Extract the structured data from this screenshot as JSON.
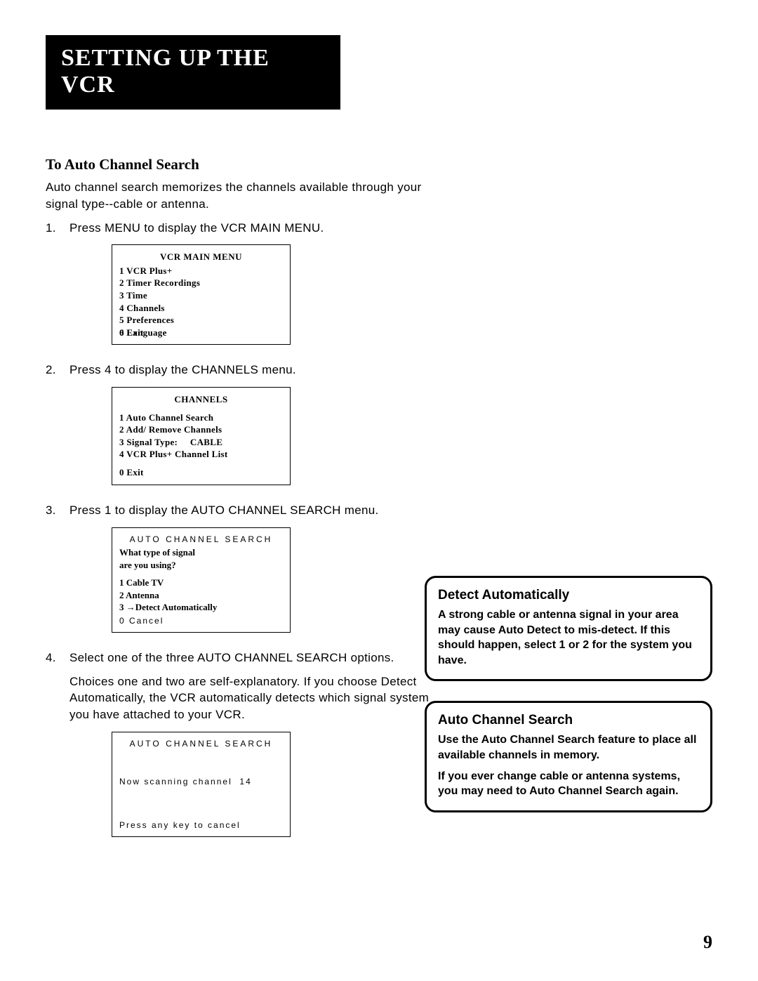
{
  "chapter_title": "SETTING UP THE VCR",
  "section_heading": "To Auto Channel Search",
  "intro_text": "Auto channel search memorizes the channels available through your signal type--cable or antenna.",
  "steps": [
    {
      "num": "1.",
      "text": "Press MENU to display the VCR MAIN MENU."
    },
    {
      "num": "2.",
      "text": "Press 4 to display the CHANNELS menu."
    },
    {
      "num": "3.",
      "text": "Press 1 to display the AUTO CHANNEL SEARCH menu."
    },
    {
      "num": "4.",
      "text": "Select one of the three AUTO CHANNEL SEARCH options."
    }
  ],
  "step4_detail": "Choices one and two are self-explanatory. If you choose Detect Automatically, the VCR automatically detects which signal system you have attached to your VCR.",
  "menu1": {
    "title": "VCR MAIN MENU",
    "items": [
      "1 VCR Plus+",
      "2 Timer Recordings",
      "3 Time",
      "4 Channels",
      "5 Preferences",
      "6 Language"
    ],
    "exit": "0 Exit"
  },
  "menu2": {
    "title": "CHANNELS",
    "items": [
      "1 Auto Channel Search",
      "2 Add/ Remove Channels",
      "3 Signal Type:     CABLE",
      "4 VCR Plus+ Channel List"
    ],
    "exit": "0 Exit"
  },
  "menu3": {
    "title": "AUTO  CHANNEL  SEARCH",
    "question1": "What type of signal",
    "question2": "are you using?",
    "items": [
      "1 Cable TV",
      "2 Antenna",
      "3 →Detect Automatically"
    ],
    "exit": "0  Cancel"
  },
  "menu4": {
    "title": "AUTO  CHANNEL  SEARCH",
    "line1": "Now scanning channel  14",
    "exit": "Press any key to cancel"
  },
  "callout1": {
    "heading": "Detect Automatically",
    "body": "A strong cable or antenna signal in your area may cause Auto Detect to mis-detect. If this should happen, select 1 or 2 for the system you have."
  },
  "callout2": {
    "heading": "Auto Channel Search",
    "body1": "Use the Auto Channel Search feature to place all available channels in memory.",
    "body2": "If you ever change cable or antenna systems, you may need to Auto Channel Search again."
  },
  "page_number": "9"
}
